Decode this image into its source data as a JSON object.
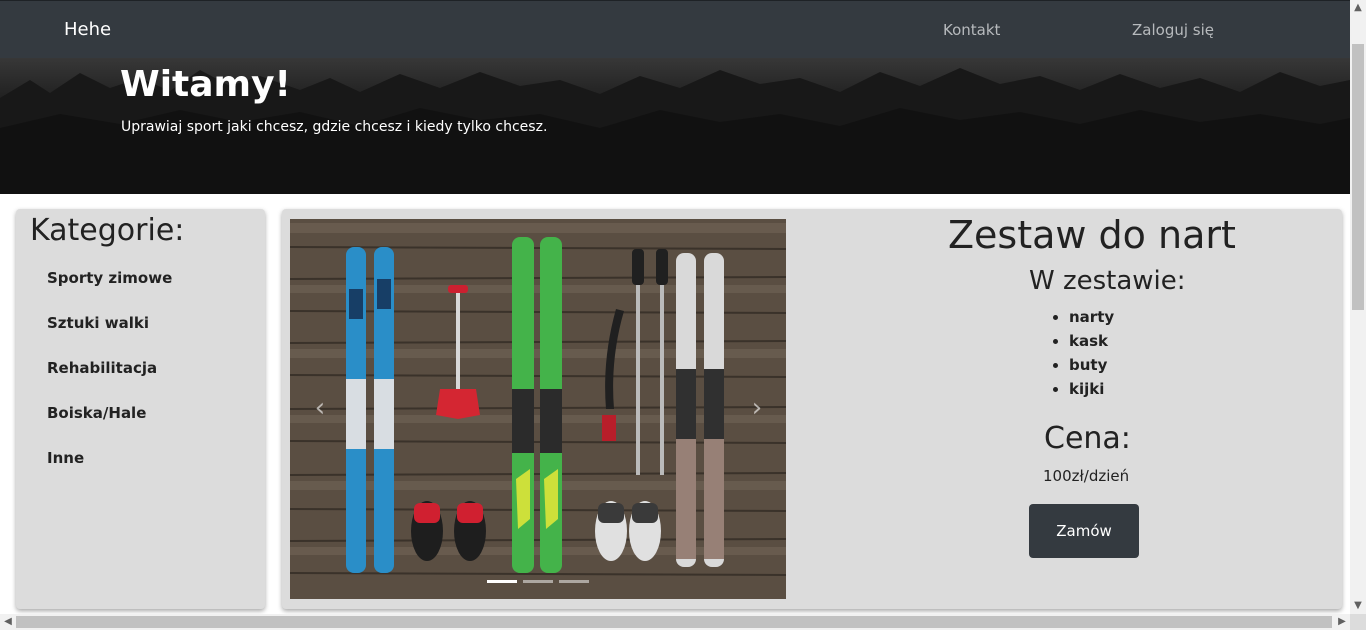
{
  "navbar": {
    "brand": "Hehe",
    "links": [
      "Kontakt",
      "Zaloguj się"
    ]
  },
  "hero": {
    "title": "Witamy!",
    "subtitle": "Uprawiaj sport jaki chcesz, gdzie chcesz i kiedy tylko chcesz."
  },
  "categories": {
    "title": "Kategorie:",
    "items": [
      "Sporty zimowe",
      "Sztuki walki",
      "Rehabilitacja",
      "Boiska/Hale",
      "Inne"
    ]
  },
  "product": {
    "title": "Zestaw do nart",
    "set_title": "W zestawie:",
    "set_items": [
      "narty",
      "kask",
      "buty",
      "kijki"
    ],
    "price_title": "Cena:",
    "price": "100zł/dzień",
    "order_label": "Zamów"
  },
  "carousel": {
    "slide_count": 3,
    "active_index": 0,
    "prev_icon": "chevron-left-icon",
    "next_icon": "chevron-right-icon"
  },
  "colors": {
    "navbar": "#343a40",
    "card": "#dcdcdc",
    "button": "#343a40"
  }
}
